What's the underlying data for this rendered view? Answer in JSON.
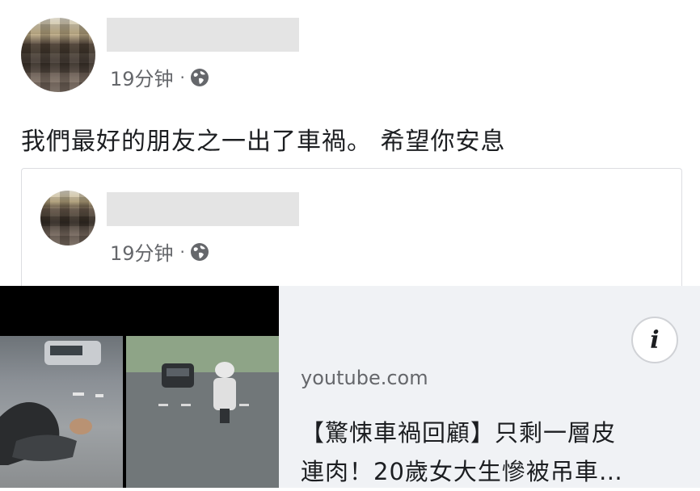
{
  "post": {
    "time": "19分钟",
    "separator": "·",
    "privacy_icon": "globe-icon",
    "text": "我們最好的朋友之一出了車禍。 希望你安息"
  },
  "shared_post": {
    "time": "19分钟",
    "separator": "·",
    "privacy_icon": "globe-icon"
  },
  "link_preview": {
    "domain": "youtube.com",
    "title_line1": "【驚悚車禍回顧】只剩一層皮",
    "title_line2": "連肉！20歲女大生慘被吊車…",
    "info_icon": "info-icon",
    "info_label": "i"
  }
}
